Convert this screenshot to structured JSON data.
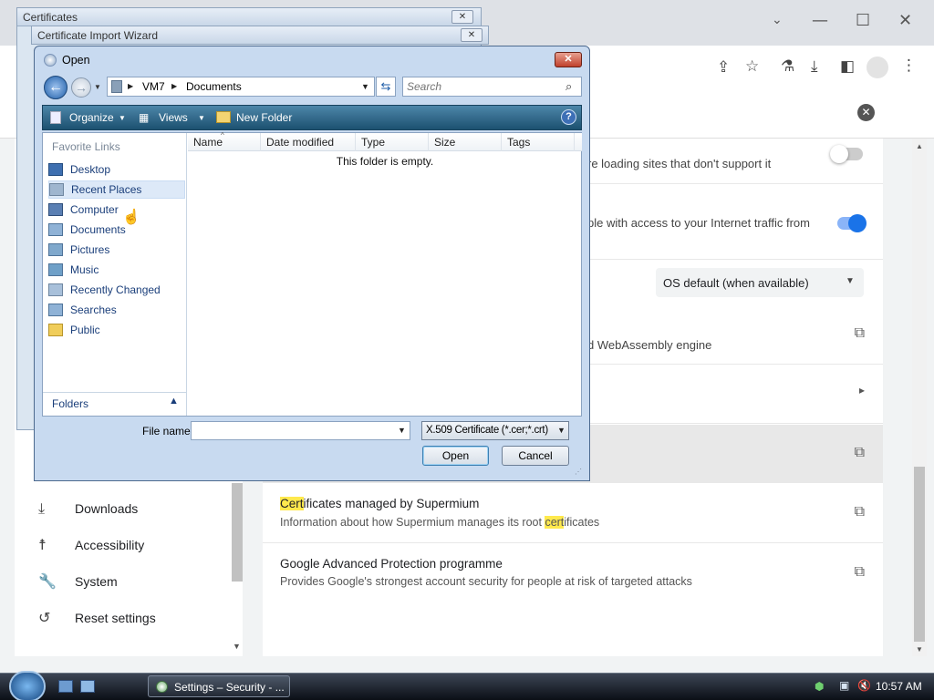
{
  "background_window": {
    "title": "Certificates"
  },
  "wizard_window": {
    "title": "Certificate Import Wizard"
  },
  "browser": {
    "settings_rows": [
      {
        "text": "re loading sites that don't support it"
      },
      {
        "text": "ple with access to your Internet traffic from"
      },
      {
        "dropdown_value": "OS default (when available)"
      },
      {
        "text": "d WebAssembly engine"
      }
    ],
    "cert_row": {
      "title_hl": "Cert",
      "title_rest": "ificates managed by Supermium",
      "sub_pre": "Information about how Supermium manages its root ",
      "sub_hl": "cert",
      "sub_post": "ificates"
    },
    "gap_row": {
      "title": "Google Advanced Protection programme",
      "sub": "Provides Google's strongest account security for people at risk of targeted attacks"
    },
    "nav": [
      {
        "icon": "download-icon",
        "label": "Downloads"
      },
      {
        "icon": "accessibility-icon",
        "label": "Accessibility"
      },
      {
        "icon": "wrench-icon",
        "label": "System"
      },
      {
        "icon": "history-icon",
        "label": "Reset settings"
      }
    ]
  },
  "open_dialog": {
    "title": "Open",
    "path": [
      "VM7",
      "Documents"
    ],
    "search_placeholder": "Search",
    "cmd": {
      "organize": "Organize",
      "views": "Views",
      "new_folder": "New Folder"
    },
    "favorites_header": "Favorite Links",
    "favorites": [
      "Desktop",
      "Recent Places",
      "Computer",
      "Documents",
      "Pictures",
      "Music",
      "Recently Changed",
      "Searches",
      "Public"
    ],
    "folders_label": "Folders",
    "columns": [
      "Name",
      "Date modified",
      "Type",
      "Size",
      "Tags"
    ],
    "empty_msg": "This folder is empty.",
    "file_name_label": "File name:",
    "file_name_value": "",
    "file_type": "X.509 Certificate (*.cer;*.crt)",
    "open_btn": "Open",
    "cancel_btn": "Cancel"
  },
  "taskbar": {
    "task_label": "Settings – Security - ...",
    "clock": "10:57 AM"
  }
}
